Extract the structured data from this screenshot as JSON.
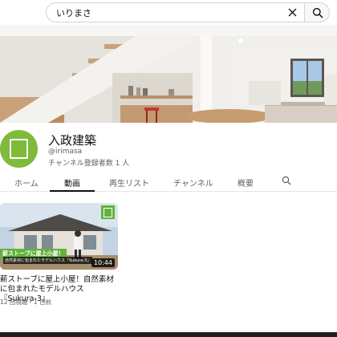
{
  "search": {
    "value": "いりまさ",
    "clear_icon": "close-icon",
    "button_icon": "search-icon"
  },
  "channel": {
    "name": "入政建築",
    "handle": "@irimasa",
    "subscribers": "チャンネル登録者数 1 人",
    "avatar_color": "#7fba3a"
  },
  "tabs": [
    {
      "label": "ホーム",
      "active": false
    },
    {
      "label": "動画",
      "active": true
    },
    {
      "label": "再生リスト",
      "active": false
    },
    {
      "label": "チャンネル",
      "active": false
    },
    {
      "label": "概要",
      "active": false
    }
  ],
  "video": {
    "duration": "10:44",
    "thumb_caption": "薪ストーブに屋上小屋！",
    "thumb_subcaption": "自然素材に包まれたモデルハウス『Sukura-3』",
    "title": "薪ストーブに屋上小屋！自然素材に包まれたモデルハウス『Sukura-3』",
    "meta": "12 回視聴・1 日前"
  },
  "colors": {
    "brand_green": "#62b33a",
    "text_primary": "#0f0f0f",
    "text_secondary": "#606060"
  }
}
